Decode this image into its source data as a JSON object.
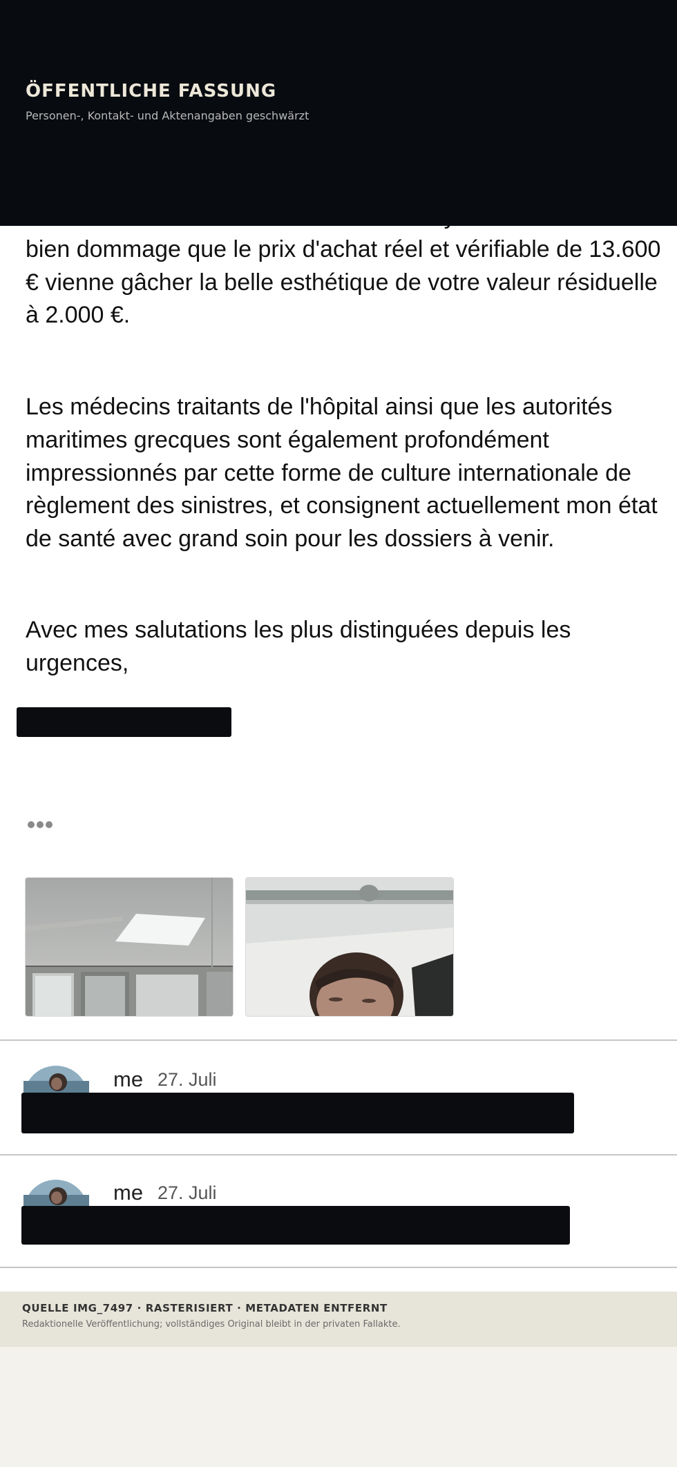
{
  "header": {
    "title": "ÖFFENTLICHE FASSUNG",
    "subtitle": "Personen-, Kontakt- und Aktenangaben geschwärzt"
  },
  "letter": {
    "paragraph_1": "d'achat a été traité avec une telle clairvoyance. Il aurait été bien dommage que le prix d'achat réel et vérifiable de 13.600 € vienne gâcher la belle esthétique de votre valeur résiduelle à 2.000 €.",
    "paragraph_2": "Les médecins traitants de l'hôpital ainsi que les autorités maritimes grecques sont également profondément impressionnés par cette forme de culture internationale de règlement des sinistres, et consignent actuellement mon état de santé avec grand soin pour les dossiers à venir.",
    "paragraph_3": "Avec mes salutations les plus distinguées depuis les urgences,"
  },
  "comments": [
    {
      "author": "me",
      "date": "27. Juli"
    },
    {
      "author": "me",
      "date": "27. Juli"
    }
  ],
  "footer": {
    "source": "QUELLE IMG_7497 · RASTERISIERT · METADATEN ENTFERNT",
    "note": "Redaktionelle Veröffentlichung; vollständiges Original bleibt in der privaten Fallakte."
  }
}
